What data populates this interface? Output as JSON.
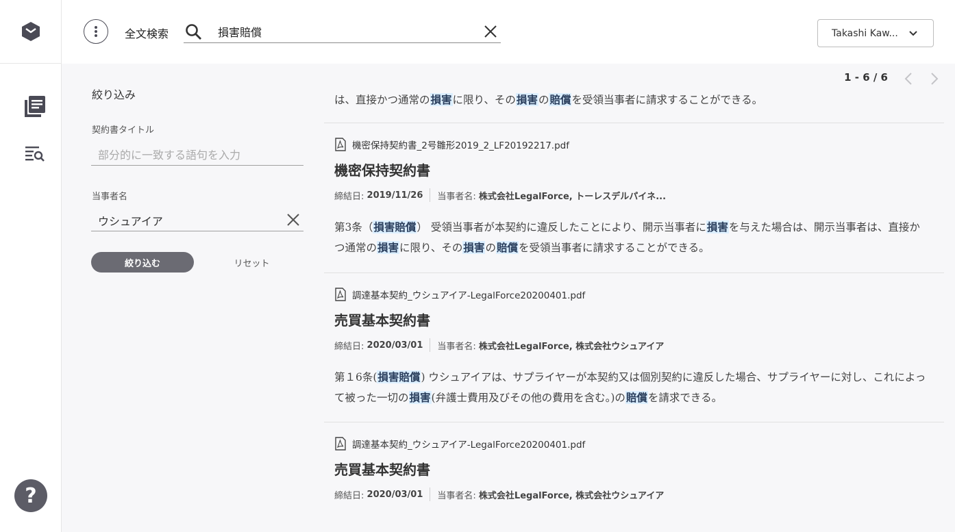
{
  "topbar": {
    "search_label": "全文検索",
    "search_value": "損害賠償",
    "user_name": "Takashi Kaw..."
  },
  "filter": {
    "title": "絞り込み",
    "title_label": "契約書タイトル",
    "title_placeholder": "部分的に一致する語句を入力",
    "party_label": "当事者名",
    "party_value": "ウシュアイア",
    "apply_label": "絞り込む",
    "reset_label": "リセット"
  },
  "results": {
    "pager": "1 - 6 / 6",
    "top_snippet": [
      {
        "t": "は、直接かつ通常の",
        "h": false
      },
      {
        "t": "損害",
        "h": true
      },
      {
        "t": "に限り、その",
        "h": false
      },
      {
        "t": "損害",
        "h": true
      },
      {
        "t": "の",
        "h": false
      },
      {
        "t": "賠償",
        "h": true
      },
      {
        "t": "を受領当事者に請求することができる。",
        "h": false
      }
    ],
    "items": [
      {
        "file": "機密保持契約書_2号雛形2019_2_LF20192217.pdf",
        "title": "機密保持契約書",
        "date_label": "締結日:",
        "date": "2019/11/26",
        "party_label": "当事者名:",
        "parties": "株式会社LegalForce, トーレスデルパイネ...",
        "snippet": [
          {
            "t": "第3条（",
            "h": false
          },
          {
            "t": "損害賠償",
            "h": true
          },
          {
            "t": "） 受領当事者が本契約に違反したことにより、開示当事者に",
            "h": false
          },
          {
            "t": "損害",
            "h": true
          },
          {
            "t": "を与えた場合は、開示当事者は、直接かつ通常の",
            "h": false
          },
          {
            "t": "損害",
            "h": true
          },
          {
            "t": "に限り、その",
            "h": false
          },
          {
            "t": "損害",
            "h": true
          },
          {
            "t": "の",
            "h": false
          },
          {
            "t": "賠償",
            "h": true
          },
          {
            "t": "を受領当事者に請求することができる。",
            "h": false
          }
        ]
      },
      {
        "file": "調達基本契約_ウシュアイア-LegalForce20200401.pdf",
        "title": "売買基本契約書",
        "date_label": "締結日:",
        "date": "2020/03/01",
        "party_label": "当事者名:",
        "parties": "株式会社LegalForce, 株式会社ウシュアイア",
        "snippet": [
          {
            "t": "第１6条(",
            "h": false
          },
          {
            "t": "損害賠償",
            "h": true
          },
          {
            "t": ") ウシュアイアは、サプライヤーが本契約又は個別契約に違反した場合、サプライヤーに対し、これによって被った一切の",
            "h": false
          },
          {
            "t": "損害",
            "h": true
          },
          {
            "t": "(弁護士費用及びその他の費用を含む。)の",
            "h": false
          },
          {
            "t": "賠償",
            "h": true
          },
          {
            "t": "を請求できる。",
            "h": false
          }
        ]
      },
      {
        "file": "調達基本契約_ウシュアイア-LegalForce20200401.pdf",
        "title": "売買基本契約書",
        "date_label": "締結日:",
        "date": "2020/03/01",
        "party_label": "当事者名:",
        "parties": "株式会社LegalForce, 株式会社ウシュアイア",
        "snippet": []
      }
    ]
  },
  "colors": {
    "highlight": "#dcefff",
    "apply_button": "#6b6b73",
    "help_button": "#5c5c66"
  }
}
